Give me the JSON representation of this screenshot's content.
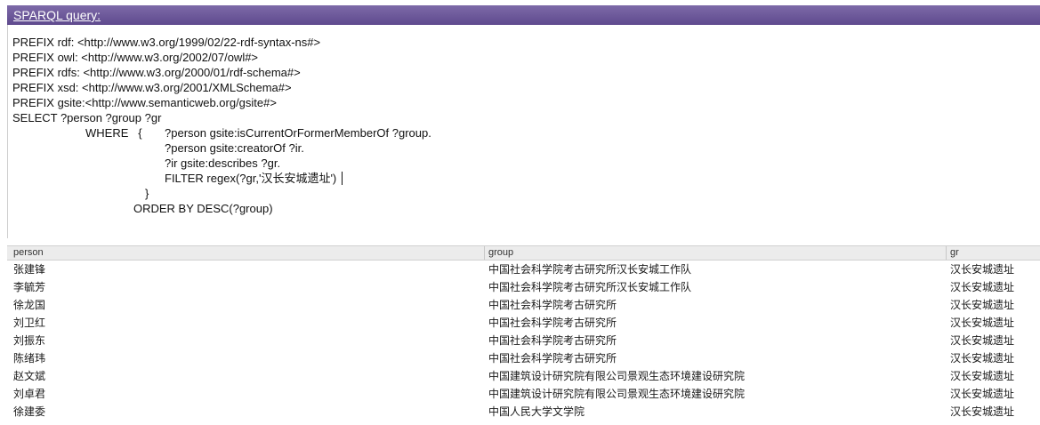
{
  "header": {
    "title": "SPARQL query:"
  },
  "query": {
    "lines": [
      "PREFIX rdf: <http://www.w3.org/1999/02/22-rdf-syntax-ns#>",
      "PREFIX owl: <http://www.w3.org/2002/07/owl#>",
      "PREFIX rdfs: <http://www.w3.org/2000/01/rdf-schema#>",
      "PREFIX xsd: <http://www.w3.org/2001/XMLSchema#>",
      "PREFIX gsite:<http://www.semanticweb.org/gsite#>",
      "SELECT ?person ?group ?gr",
      "WHERE   {",
      "?person gsite:isCurrentOrFormerMemberOf ?group.",
      "?person gsite:creatorOf ?ir.",
      "?ir gsite:describes ?gr.",
      "FILTER regex(?gr,'汉长安城遗址')",
      "}",
      "ORDER BY DESC(?group)"
    ]
  },
  "results": {
    "columns": [
      "person",
      "group",
      "gr"
    ],
    "rows": [
      [
        "张建锋",
        "中国社会科学院考古研究所汉长安城工作队",
        "汉长安城遗址"
      ],
      [
        "李毓芳",
        "中国社会科学院考古研究所汉长安城工作队",
        "汉长安城遗址"
      ],
      [
        "徐龙国",
        "中国社会科学院考古研究所",
        "汉长安城遗址"
      ],
      [
        "刘卫红",
        "中国社会科学院考古研究所",
        "汉长安城遗址"
      ],
      [
        "刘振东",
        "中国社会科学院考古研究所",
        "汉长安城遗址"
      ],
      [
        "陈绪玮",
        "中国社会科学院考古研究所",
        "汉长安城遗址"
      ],
      [
        "赵文斌",
        "中国建筑设计研究院有限公司景观生态环境建设研究院",
        "汉长安城遗址"
      ],
      [
        "刘卓君",
        "中国建筑设计研究院有限公司景观生态环境建设研究院",
        "汉长安城遗址"
      ],
      [
        "徐建委",
        "中国人民大学文学院",
        "汉长安城遗址"
      ]
    ]
  },
  "colors": {
    "header_bg": "#6a559a",
    "header_text": "#ffffff",
    "results_header_bg": "#ececec"
  }
}
